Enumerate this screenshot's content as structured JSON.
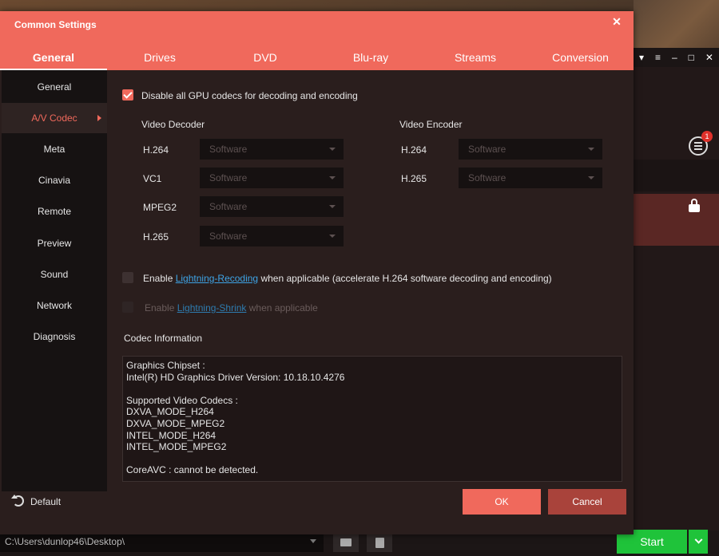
{
  "dialog": {
    "title": "Common Settings",
    "tabs": [
      {
        "label": "General",
        "active": true
      },
      {
        "label": "Drives",
        "active": false
      },
      {
        "label": "DVD",
        "active": false
      },
      {
        "label": "Blu-ray",
        "active": false
      },
      {
        "label": "Streams",
        "active": false
      },
      {
        "label": "Conversion",
        "active": false
      }
    ],
    "sidebar": [
      {
        "label": "General",
        "active": false
      },
      {
        "label": "A/V Codec",
        "active": true
      },
      {
        "label": "Meta",
        "active": false
      },
      {
        "label": "Cinavia",
        "active": false
      },
      {
        "label": "Remote",
        "active": false
      },
      {
        "label": "Preview",
        "active": false
      },
      {
        "label": "Sound",
        "active": false
      },
      {
        "label": "Network",
        "active": false
      },
      {
        "label": "Diagnosis",
        "active": false
      }
    ],
    "content": {
      "disable_gpu": {
        "label": "Disable all GPU codecs for decoding and encoding",
        "checked": true
      },
      "video_decoder": {
        "heading": "Video Decoder",
        "rows": [
          {
            "codec": "H.264",
            "value": "Software"
          },
          {
            "codec": "VC1",
            "value": "Software"
          },
          {
            "codec": "MPEG2",
            "value": "Software"
          },
          {
            "codec": "H.265",
            "value": "Software"
          }
        ]
      },
      "video_encoder": {
        "heading": "Video Encoder",
        "rows": [
          {
            "codec": "H.264",
            "value": "Software"
          },
          {
            "codec": "H.265",
            "value": "Software"
          }
        ]
      },
      "lightning_recoding": {
        "prefix": "Enable ",
        "link": "Lightning-Recoding",
        "suffix": " when applicable (accelerate H.264 software decoding and encoding)",
        "checked": false
      },
      "lightning_shrink": {
        "prefix": "Enable ",
        "link": "Lightning-Shrink",
        "suffix": " when applicable",
        "checked": false,
        "disabled": true
      },
      "codec_info_heading": "Codec Information",
      "codec_info_lines": [
        "Graphics Chipset :",
        "Intel(R) HD Graphics Driver Version: 10.18.10.4276",
        "",
        "Supported Video Codecs :",
        "DXVA_MODE_H264",
        "DXVA_MODE_MPEG2",
        "INTEL_MODE_H264",
        "INTEL_MODE_MPEG2",
        "",
        "CoreAVC : cannot be detected."
      ]
    },
    "footer": {
      "default_label": "Default",
      "ok_label": "OK",
      "cancel_label": "Cancel"
    }
  },
  "background": {
    "path": "C:\\Users\\dunlop46\\Desktop\\",
    "start_label": "Start",
    "badge_count": "1"
  },
  "colors": {
    "accent": "#f0695c",
    "start_green": "#1fc33a",
    "link": "#3ea4e6",
    "cancel": "#a9433b"
  }
}
